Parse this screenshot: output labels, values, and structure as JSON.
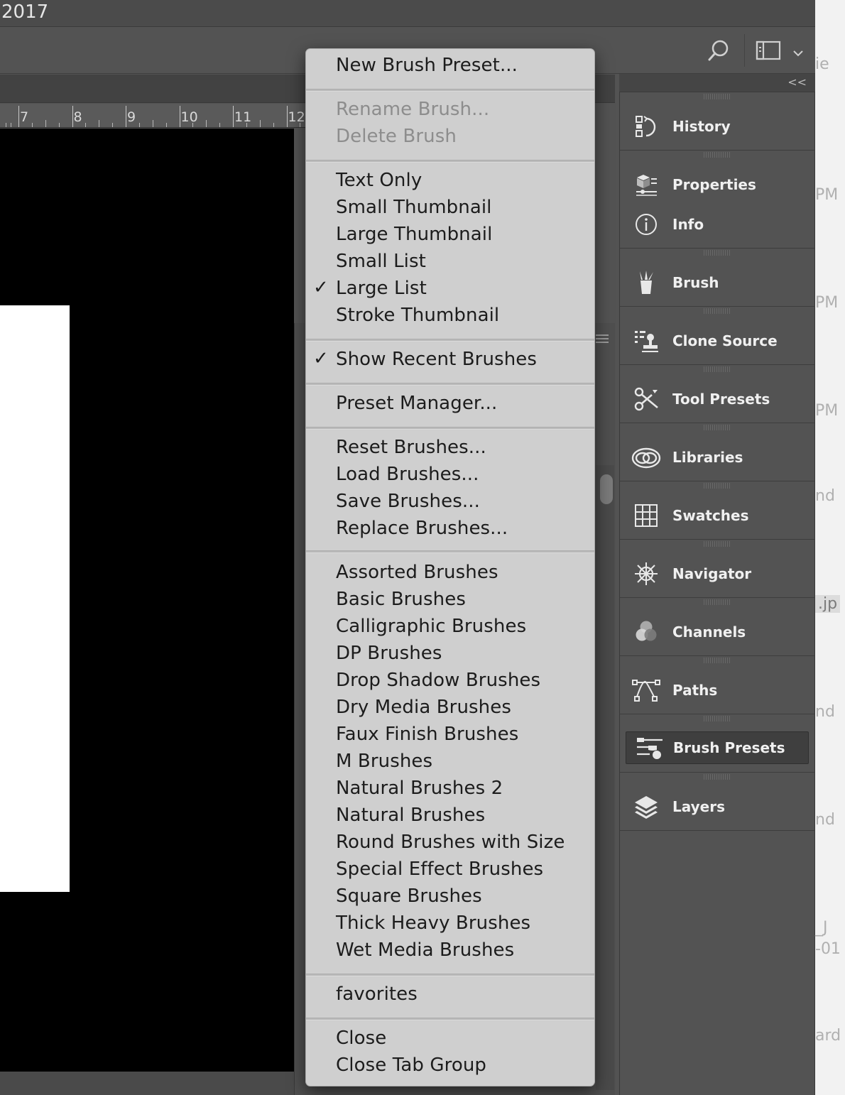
{
  "window": {
    "title": "2017"
  },
  "ruler": {
    "labels": [
      "7",
      "8",
      "9",
      "10",
      "11",
      "12"
    ]
  },
  "dock": {
    "collapse_label": "<<",
    "items": [
      {
        "label": "History",
        "icon": "history-icon"
      },
      {
        "label": "Properties",
        "icon": "properties-icon"
      },
      {
        "label": "Info",
        "icon": "info-icon"
      },
      {
        "label": "Brush",
        "icon": "brush-icon"
      },
      {
        "label": "Clone Source",
        "icon": "clone-source-icon"
      },
      {
        "label": "Tool Presets",
        "icon": "tool-presets-icon"
      },
      {
        "label": "Libraries",
        "icon": "libraries-icon"
      },
      {
        "label": "Swatches",
        "icon": "swatches-icon"
      },
      {
        "label": "Navigator",
        "icon": "navigator-icon"
      },
      {
        "label": "Channels",
        "icon": "channels-icon"
      },
      {
        "label": "Paths",
        "icon": "paths-icon"
      },
      {
        "label": "Brush Presets",
        "icon": "brush-presets-icon",
        "selected": true
      },
      {
        "label": "Layers",
        "icon": "layers-icon"
      }
    ]
  },
  "right_edge_fragments": [
    "ie",
    "PM",
    "PM",
    "PM",
    "nd",
    ".jp",
    "nd",
    "nd",
    "_J",
    "-01",
    "ard"
  ],
  "menu": {
    "items": [
      {
        "label": "New Brush Preset..."
      },
      {
        "label": "Rename Brush...",
        "disabled": true
      },
      {
        "label": "Delete Brush",
        "disabled": true
      },
      {
        "label": "Text Only"
      },
      {
        "label": "Small Thumbnail"
      },
      {
        "label": "Large Thumbnail"
      },
      {
        "label": "Small List"
      },
      {
        "label": "Large List",
        "checked": true
      },
      {
        "label": "Stroke Thumbnail"
      },
      {
        "label": "Show Recent Brushes",
        "checked": true
      },
      {
        "label": "Preset Manager..."
      },
      {
        "label": "Reset Brushes..."
      },
      {
        "label": "Load Brushes..."
      },
      {
        "label": "Save Brushes..."
      },
      {
        "label": "Replace Brushes..."
      },
      {
        "label": "Assorted Brushes"
      },
      {
        "label": "Basic Brushes"
      },
      {
        "label": "Calligraphic Brushes"
      },
      {
        "label": "DP Brushes"
      },
      {
        "label": "Drop Shadow Brushes"
      },
      {
        "label": "Dry Media Brushes"
      },
      {
        "label": "Faux Finish Brushes"
      },
      {
        "label": "M Brushes"
      },
      {
        "label": "Natural Brushes 2"
      },
      {
        "label": "Natural Brushes"
      },
      {
        "label": "Round Brushes with Size"
      },
      {
        "label": "Special Effect Brushes"
      },
      {
        "label": "Square Brushes"
      },
      {
        "label": "Thick Heavy Brushes"
      },
      {
        "label": "Wet Media Brushes"
      },
      {
        "label": "favorites"
      },
      {
        "label": "Close"
      },
      {
        "label": "Close Tab Group"
      }
    ],
    "checkmark": "✓"
  },
  "colors": {
    "app_bg": "#535353",
    "menu_bg": "#cfcfcf",
    "menu_text": "#1c1c1c",
    "menu_disabled_text": "#8d8d8d",
    "dock_label": "#f0f0f0"
  }
}
